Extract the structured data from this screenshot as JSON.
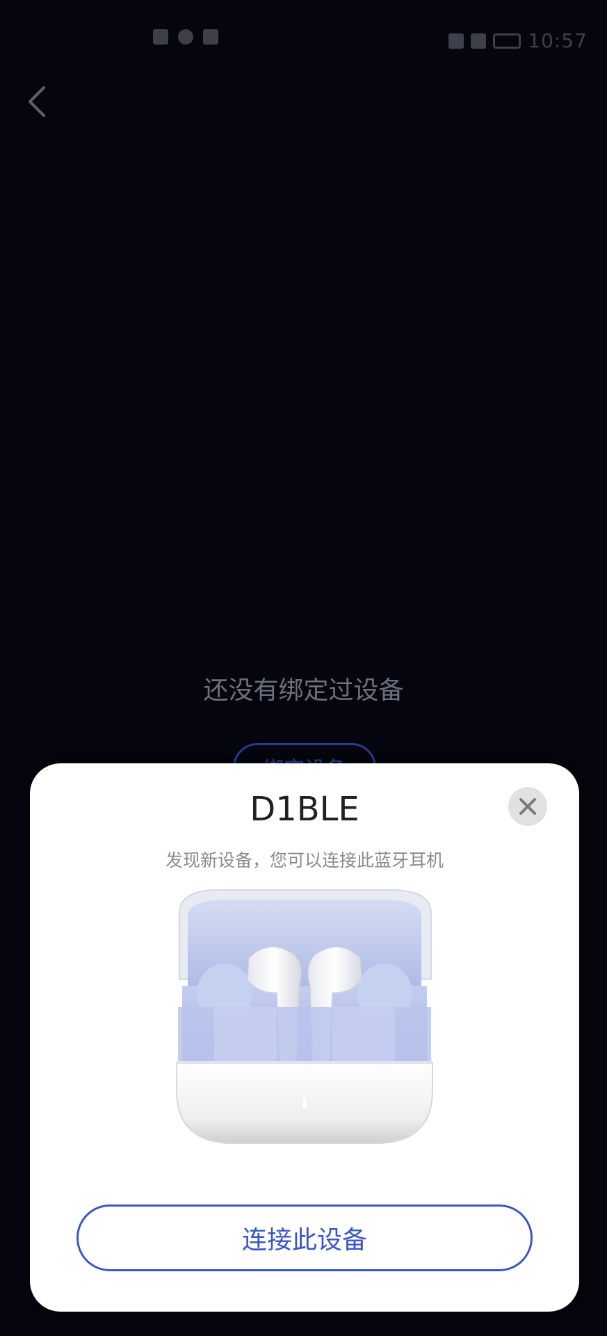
{
  "status_bar": {
    "time": "10:57",
    "icons": [
      "signal-icon",
      "wifi-icon",
      "notification-icon",
      "battery-icon"
    ]
  },
  "nav": {
    "back_icon": "chevron-left-icon"
  },
  "empty_state": {
    "title": "还没有绑定过设备",
    "bind_button_label": "绑定设备"
  },
  "modal": {
    "device_name": "D1BLE",
    "description": "发现新设备，您可以连接此蓝牙耳机",
    "close_icon": "close-icon",
    "image_icon": "earbuds-case-icon",
    "connect_label": "连接此设备"
  },
  "colors": {
    "background": "#05060d",
    "accent": "#3b57c7",
    "card": "#ffffff"
  }
}
